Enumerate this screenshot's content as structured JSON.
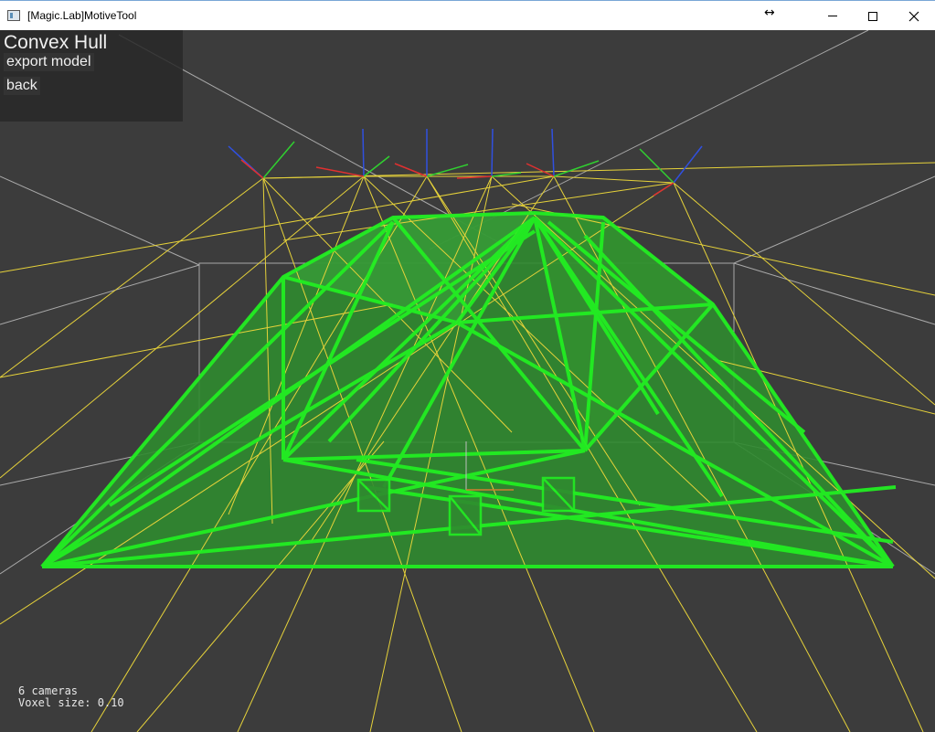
{
  "window": {
    "title": "[Magic.Lab]MotiveTool",
    "resize_glyph": "↔",
    "icons": {
      "app": "app-window-icon",
      "minimize": "minimize-icon",
      "maximize": "maximize-icon",
      "close": "close-icon"
    }
  },
  "panel": {
    "title": "Convex Hull",
    "export_label": "export model",
    "back_label": "back"
  },
  "status": {
    "cameras": "6 cameras",
    "voxel": "Voxel size: 0.10"
  },
  "colors": {
    "background": "#3c3c3c",
    "hull_fill": "#2f8a2f",
    "hull_edge": "#22ee22",
    "camera_ray": "#e6d23a",
    "grid": "#bdbdbd",
    "axis_x": "#e03030",
    "axis_y": "#30d030",
    "axis_z": "#3050e0"
  }
}
